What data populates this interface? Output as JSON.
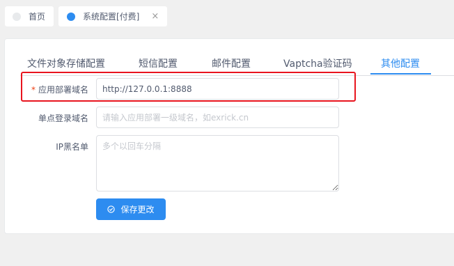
{
  "tabbar": {
    "tabs": [
      {
        "label": "首页"
      },
      {
        "label": "系统配置[付费]",
        "close": "×"
      }
    ]
  },
  "config_tabs": [
    {
      "label": "文件对象存储配置"
    },
    {
      "label": "短信配置"
    },
    {
      "label": "邮件配置"
    },
    {
      "label": "Vaptcha验证码"
    },
    {
      "label": "其他配置"
    }
  ],
  "active_tab": "其他配置",
  "form": {
    "domain_label": "应用部署域名",
    "domain_required_mark": "*",
    "domain_value": "http://127.0.0.1:8888",
    "sso_label": "单点登录域名",
    "sso_placeholder": "请输入应用部署一级域名，如exrick.cn",
    "ip_label": "IP黑名单",
    "ip_placeholder": "多个以回车分隔",
    "save_label": "保存更改"
  },
  "colors": {
    "accent": "#2d8cf0",
    "highlight": "#e8141e",
    "required": "#ed4014"
  },
  "icons": {
    "home_dot": "grey-dot-icon",
    "config_dot": "blue-dot-icon",
    "save": "check-circle-icon"
  }
}
